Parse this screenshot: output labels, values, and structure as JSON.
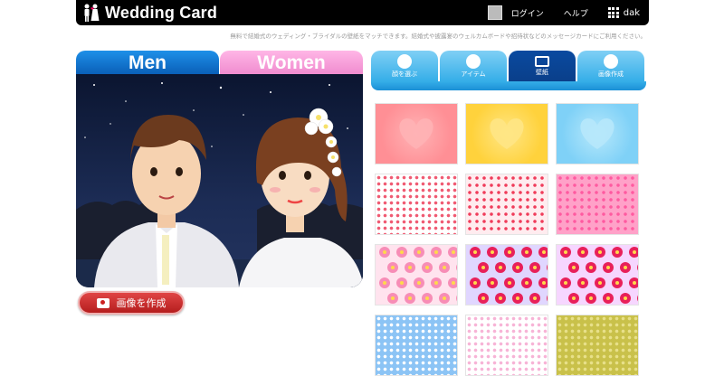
{
  "header": {
    "app_title": "Wedding Card",
    "login_label": "ログイン",
    "help_label": "ヘルプ",
    "user_name": "dak",
    "tagline": "無料で結婚式のウェディング・ブライダルの壁紙をマッチできます。結婚式や披露宴のウェルカムボードや招待状などのメッセージカードにご利用ください。"
  },
  "left_panel": {
    "tab_men": "Men",
    "tab_women": "Women",
    "create_button": "画像を作成"
  },
  "right_panel": {
    "tabs": [
      {
        "label": "顔を選ぶ",
        "icon": "smile-icon",
        "active": false
      },
      {
        "label": "アイテム",
        "icon": "star-icon",
        "active": false
      },
      {
        "label": "壁紙",
        "icon": "wallpaper-icon",
        "active": true
      },
      {
        "label": "画像作成",
        "icon": "camera-icon",
        "active": false
      }
    ],
    "wallpapers": [
      {
        "name": "pink-heart",
        "colors": [
          "#ff8f95",
          "#ffb3b5"
        ]
      },
      {
        "name": "yellow-heart",
        "colors": [
          "#ffd23c",
          "#ffe685"
        ]
      },
      {
        "name": "blue-heart",
        "colors": [
          "#7fd1f7",
          "#b7e8fb"
        ]
      },
      {
        "name": "red-dots-white",
        "colors": [
          "#ffffff",
          "#f05a72"
        ]
      },
      {
        "name": "pink-hearts-white",
        "colors": [
          "#ffecef",
          "#f03c5a"
        ]
      },
      {
        "name": "pink-hearts-pink",
        "colors": [
          "#ffa1c8",
          "#ff5aa0"
        ]
      },
      {
        "name": "pink-flowers-light",
        "colors": [
          "#ffe3ee",
          "#f78db6"
        ]
      },
      {
        "name": "red-flowers-lavender",
        "colors": [
          "#e0d6ff",
          "#e8205a"
        ]
      },
      {
        "name": "red-flowers-pink",
        "colors": [
          "#f6d6ff",
          "#e8205a"
        ]
      },
      {
        "name": "blue-dots",
        "colors": [
          "#8cc4f5",
          "#ffffff"
        ]
      },
      {
        "name": "pastel-dots",
        "colors": [
          "#ffffff",
          "#f7b3d6"
        ]
      },
      {
        "name": "olive-dots",
        "colors": [
          "#c9c14a",
          "#e8e08a"
        ]
      }
    ]
  }
}
